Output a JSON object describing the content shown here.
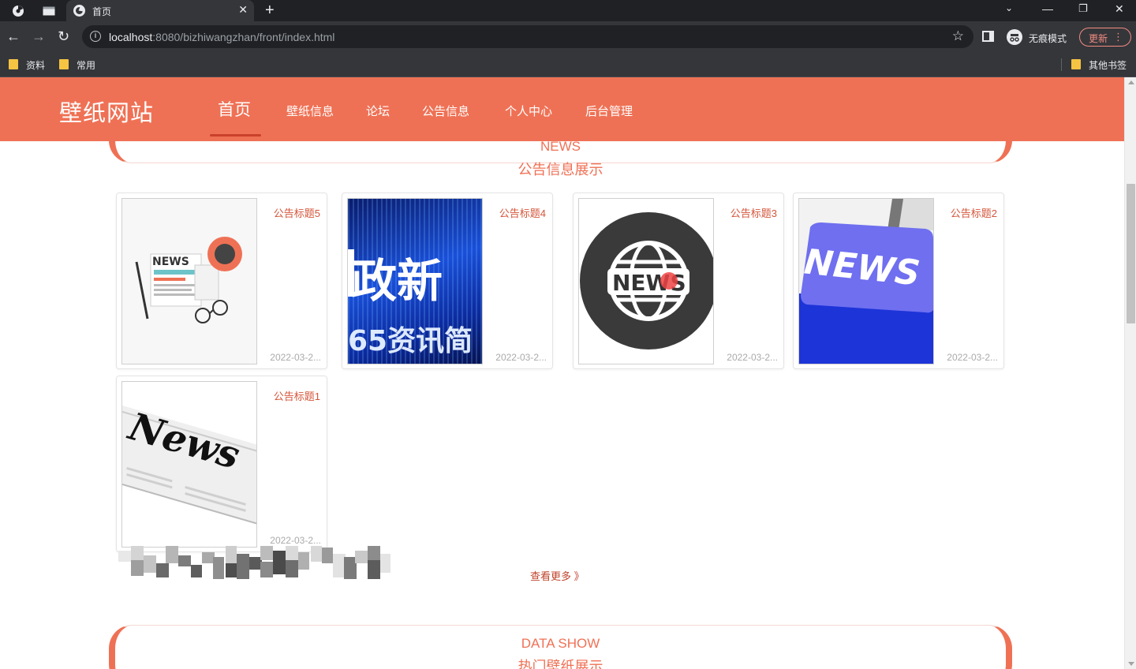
{
  "browser": {
    "tab_title": "首页",
    "url_host": "localhost",
    "url_rest": ":8080/bizhiwangzhan/front/index.html",
    "incognito_label": "无痕模式",
    "update_label": "更新",
    "bookmarks": [
      "资料",
      "常用"
    ],
    "other_bookmarks": "其他书签"
  },
  "site": {
    "logo": "壁纸网站",
    "nav": [
      {
        "label": "首页",
        "active": true
      },
      {
        "label": "壁纸信息"
      },
      {
        "label": "论坛"
      },
      {
        "label": "公告信息"
      },
      {
        "label": "个人中心"
      },
      {
        "label": "后台管理"
      }
    ]
  },
  "news_section": {
    "en": "NEWS",
    "cn": "公告信息展示",
    "items": [
      {
        "title": "公告标题5",
        "date": "2022-03-2...",
        "image": "news-paper-illustration"
      },
      {
        "title": "公告标题4",
        "date": "2022-03-2...",
        "image": "finance-news-banner"
      },
      {
        "title": "公告标题3",
        "date": "2022-03-2...",
        "image": "news-globe-icon"
      },
      {
        "title": "公告标题2",
        "date": "2022-03-2...",
        "image": "news-keyboard-key"
      },
      {
        "title": "公告标题1",
        "date": "2022-03-2...",
        "image": "newspaper-photo"
      }
    ],
    "banner_text_1": "政新",
    "banner_text_2": "65资讯简",
    "news_word": "NEWS",
    "news_word_2": "News",
    "more_label": "查看更多 》"
  },
  "data_section": {
    "en": "DATA SHOW",
    "cn": "热门壁纸展示"
  },
  "colors": {
    "brand": "#ef7155",
    "title": "#d4553a"
  }
}
